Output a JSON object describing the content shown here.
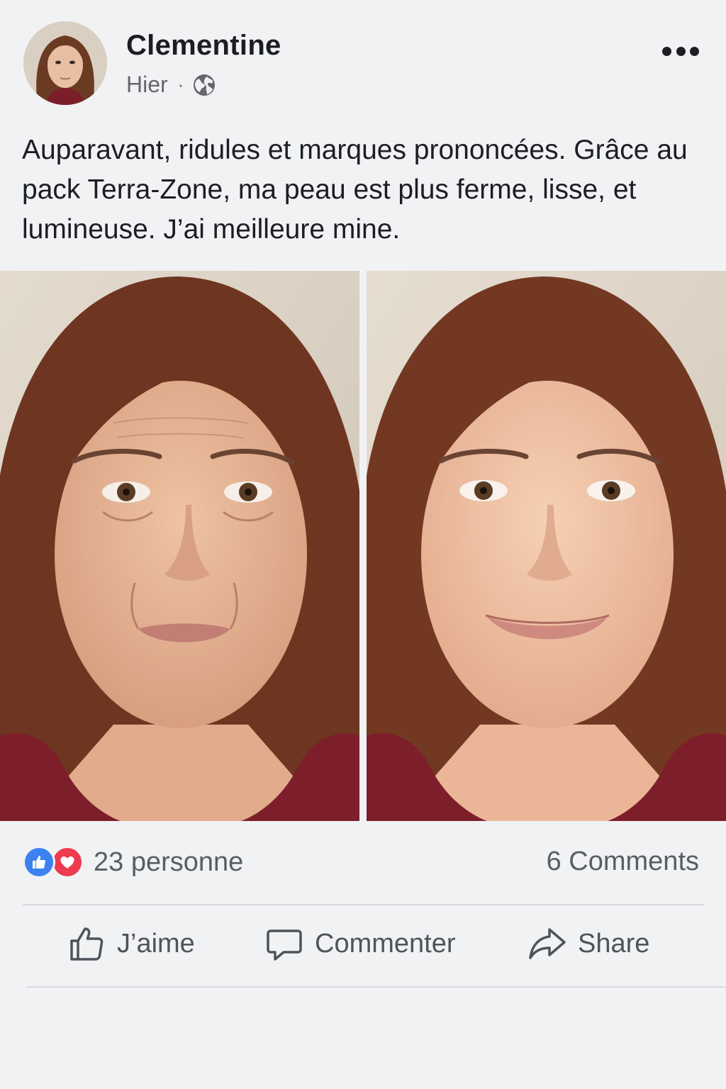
{
  "post": {
    "author": "Clementine",
    "time": "Hier",
    "separator": "·",
    "privacy_icon": "globe-icon",
    "menu_icon": "more-options-icon",
    "text": "Auparavant, ridules et marques prononcées. Grâce au pack Terra-Zone, ma peau est plus ferme, lisse, et lumineuse. J’ai meilleure mine."
  },
  "photos": [
    {
      "name": "photo-before",
      "description_icon": "face-photo"
    },
    {
      "name": "photo-after",
      "description_icon": "face-photo"
    }
  ],
  "reactions": {
    "icons": [
      "like-reaction-icon",
      "love-reaction-icon"
    ],
    "count_label": "23 personne",
    "comments_label": "6 Comments"
  },
  "actions": {
    "like_label": "J’aime",
    "comment_label": "Commenter",
    "share_label": "Share"
  },
  "colors": {
    "background": "#f1f2f4",
    "like_blue": "#3b82f0",
    "love_red": "#ee3a4f",
    "muted_text": "#65676b"
  }
}
